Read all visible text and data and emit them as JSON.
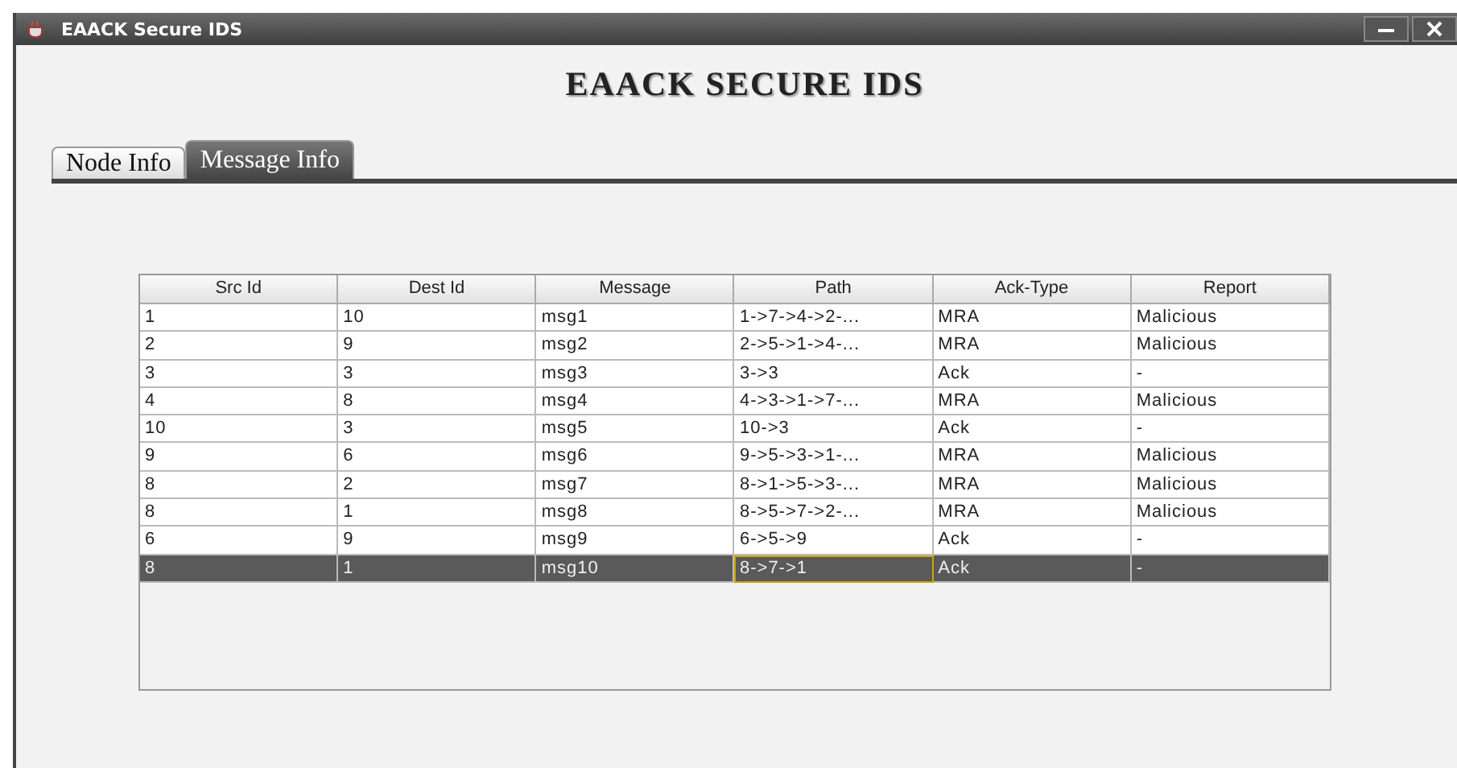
{
  "window": {
    "title": "EAACK Secure IDS"
  },
  "heading": "EAACK SECURE IDS",
  "tabs": [
    {
      "label": "Node Info",
      "selected": false
    },
    {
      "label": "Message Info",
      "selected": true
    }
  ],
  "table": {
    "columns": [
      "Src Id",
      "Dest Id",
      "Message",
      "Path",
      "Ack-Type",
      "Report"
    ],
    "rows": [
      {
        "selected": false,
        "cells": [
          {
            "text": "1",
            "focused": false
          },
          {
            "text": "10",
            "focused": false
          },
          {
            "text": "msg1",
            "focused": false
          },
          {
            "text": "1->7->4->2-...",
            "focused": false
          },
          {
            "text": "MRA",
            "focused": false
          },
          {
            "text": "Malicious",
            "focused": false
          }
        ]
      },
      {
        "selected": false,
        "cells": [
          {
            "text": "2",
            "focused": false
          },
          {
            "text": "9",
            "focused": false
          },
          {
            "text": "msg2",
            "focused": false
          },
          {
            "text": "2->5->1->4-...",
            "focused": false
          },
          {
            "text": "MRA",
            "focused": false
          },
          {
            "text": "Malicious",
            "focused": false
          }
        ]
      },
      {
        "selected": false,
        "cells": [
          {
            "text": "3",
            "focused": false
          },
          {
            "text": "3",
            "focused": false
          },
          {
            "text": "msg3",
            "focused": false
          },
          {
            "text": "3->3",
            "focused": false
          },
          {
            "text": "Ack",
            "focused": false
          },
          {
            "text": "-",
            "focused": false
          }
        ]
      },
      {
        "selected": false,
        "cells": [
          {
            "text": "4",
            "focused": false
          },
          {
            "text": "8",
            "focused": false
          },
          {
            "text": "msg4",
            "focused": false
          },
          {
            "text": "4->3->1->7-...",
            "focused": false
          },
          {
            "text": "MRA",
            "focused": false
          },
          {
            "text": "Malicious",
            "focused": false
          }
        ]
      },
      {
        "selected": false,
        "cells": [
          {
            "text": "10",
            "focused": false
          },
          {
            "text": "3",
            "focused": false
          },
          {
            "text": "msg5",
            "focused": false
          },
          {
            "text": "10->3",
            "focused": false
          },
          {
            "text": "Ack",
            "focused": false
          },
          {
            "text": "-",
            "focused": false
          }
        ]
      },
      {
        "selected": false,
        "cells": [
          {
            "text": "9",
            "focused": false
          },
          {
            "text": "6",
            "focused": false
          },
          {
            "text": "msg6",
            "focused": false
          },
          {
            "text": "9->5->3->1-...",
            "focused": false
          },
          {
            "text": "MRA",
            "focused": false
          },
          {
            "text": "Malicious",
            "focused": false
          }
        ]
      },
      {
        "selected": false,
        "cells": [
          {
            "text": "8",
            "focused": false
          },
          {
            "text": "2",
            "focused": false
          },
          {
            "text": "msg7",
            "focused": false
          },
          {
            "text": "8->1->5->3-...",
            "focused": false
          },
          {
            "text": "MRA",
            "focused": false
          },
          {
            "text": "Malicious",
            "focused": false
          }
        ]
      },
      {
        "selected": false,
        "cells": [
          {
            "text": "8",
            "focused": false
          },
          {
            "text": "1",
            "focused": false
          },
          {
            "text": "msg8",
            "focused": false
          },
          {
            "text": "8->5->7->2-...",
            "focused": false
          },
          {
            "text": "MRA",
            "focused": false
          },
          {
            "text": "Malicious",
            "focused": false
          }
        ]
      },
      {
        "selected": false,
        "cells": [
          {
            "text": "6",
            "focused": false
          },
          {
            "text": "9",
            "focused": false
          },
          {
            "text": "msg9",
            "focused": false
          },
          {
            "text": "6->5->9",
            "focused": false
          },
          {
            "text": "Ack",
            "focused": false
          },
          {
            "text": "-",
            "focused": false
          }
        ]
      },
      {
        "selected": true,
        "cells": [
          {
            "text": "8",
            "focused": false
          },
          {
            "text": "1",
            "focused": false
          },
          {
            "text": "msg10",
            "focused": false
          },
          {
            "text": "8->7->1",
            "focused": true
          },
          {
            "text": "Ack",
            "focused": false
          },
          {
            "text": "-",
            "focused": false
          }
        ]
      }
    ]
  }
}
